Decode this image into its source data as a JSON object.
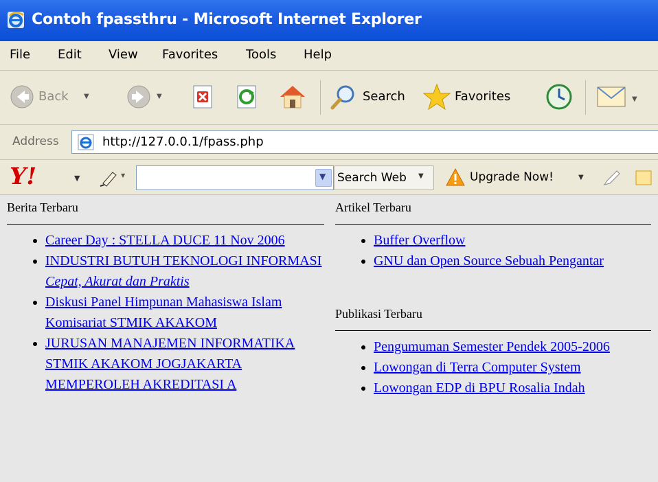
{
  "window": {
    "title": "Contoh fpassthru - Microsoft Internet Explorer"
  },
  "menu": [
    "File",
    "Edit",
    "View",
    "Favorites",
    "Tools",
    "Help"
  ],
  "toolbar": {
    "back_label": "Back",
    "search_label": "Search",
    "favorites_label": "Favorites"
  },
  "address": {
    "label": "Address",
    "url": "http://127.0.0.1/fpass.php"
  },
  "yahoo": {
    "logo": "Y!",
    "search_value": "",
    "search_button": "Search Web",
    "upgrade_label": "Upgrade Now!"
  },
  "content": {
    "berita": {
      "title": "Berita Terbaru",
      "items": [
        {
          "text": "Career Day : STELLA DUCE 11 Nov 2006"
        },
        {
          "text": "INDUSTRI BUTUH TEKNOLOGI INFORMASI",
          "sub": "Cepat, Akurat dan Praktis"
        },
        {
          "text": "Diskusi Panel Himpunan Mahasiswa Islam Komisariat STMIK AKAKOM"
        },
        {
          "text": "JURUSAN MANAJEMEN INFORMATIKA STMIK AKAKOM JOGJAKARTA MEMPEROLEH AKREDITASI A"
        }
      ]
    },
    "artikel": {
      "title": "Artikel Terbaru",
      "items": [
        {
          "text": "Buffer Overflow"
        },
        {
          "text": "GNU dan Open Source Sebuah Pengantar"
        }
      ]
    },
    "publikasi": {
      "title": "Publikasi Terbaru",
      "items": [
        {
          "text": "Pengumuman Semester Pendek 2005-2006"
        },
        {
          "text": "Lowongan di Terra Computer System"
        },
        {
          "text": "Lowongan EDP di BPU Rosalia Indah"
        }
      ]
    }
  },
  "colors": {
    "titlebar": "#0a4fd6",
    "chrome": "#ece9d8",
    "content_bg": "#e7e7e7",
    "link": "#0000ee"
  },
  "icons": [
    "ie-icon",
    "back-icon",
    "forward-icon",
    "stop-icon",
    "refresh-icon",
    "home-icon",
    "search-icon",
    "favorites-star-icon",
    "history-icon",
    "mail-icon",
    "yahoo-logo",
    "highlighter-icon",
    "warning-icon",
    "pencil-icon"
  ]
}
